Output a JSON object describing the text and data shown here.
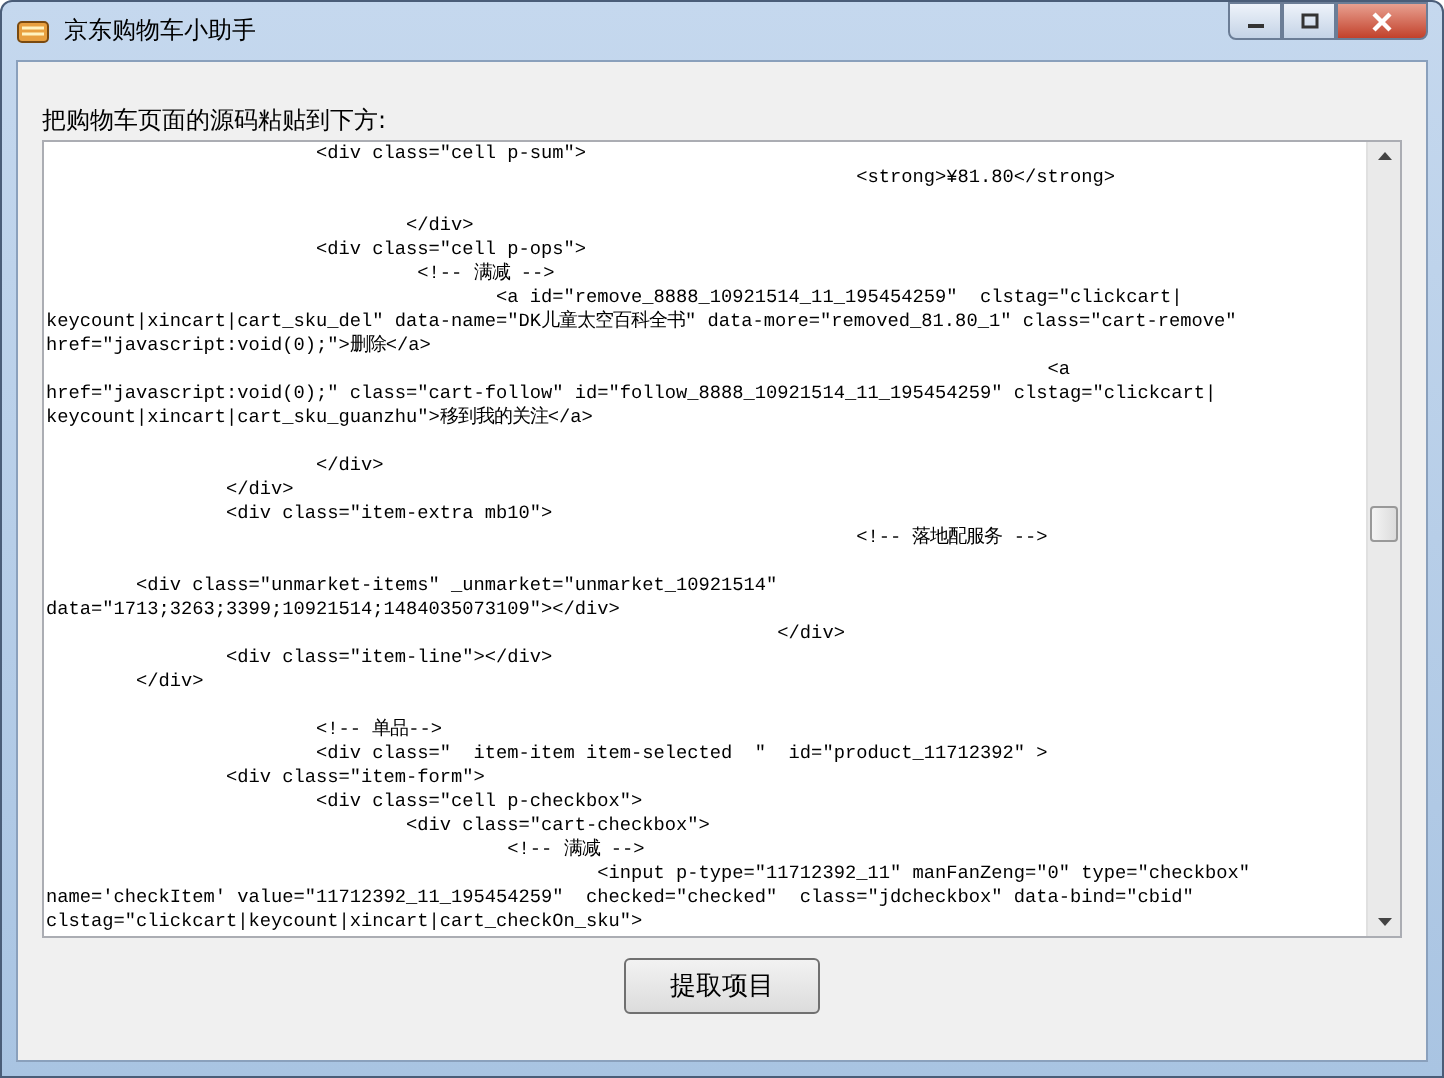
{
  "window": {
    "title": "京东购物车小助手"
  },
  "prompt": "把购物车页面的源码粘贴到下方:",
  "source_field": {
    "value": "                        <div class=\"cell p-sum\">\n                                                                        <strong>¥81.80</strong>\n\n                                </div>\n                        <div class=\"cell p-ops\">\n                                 <!-- 满减 -->\n                                        <a id=\"remove_8888_10921514_11_195454259\"  clstag=\"clickcart|\nkeycount|xincart|cart_sku_del\" data-name=\"DK儿童太空百科全书\" data-more=\"removed_81.80_1\" class=\"cart-remove\"\nhref=\"javascript:void(0);\">删除</a>\n                                                                                         <a\nhref=\"javascript:void(0);\" class=\"cart-follow\" id=\"follow_8888_10921514_11_195454259\" clstag=\"clickcart|\nkeycount|xincart|cart_sku_guanzhu\">移到我的关注</a>\n\n                        </div>\n                </div>\n                <div class=\"item-extra mb10\">\n                                                                        <!-- 落地配服务 -->\n\n        <div class=\"unmarket-items\" _unmarket=\"unmarket_10921514\"\ndata=\"1713;3263;3399;10921514;1484035073109\"></div>\n                                                                 </div>\n                <div class=\"item-line\"></div>\n        </div>\n\n                        <!-- 单品-->\n                        <div class=\"  item-item item-selected  \"  id=\"product_11712392\" >\n                <div class=\"item-form\">\n                        <div class=\"cell p-checkbox\">\n                                <div class=\"cart-checkbox\">\n                                         <!-- 满减 -->\n                                                 <input p-type=\"11712392_11\" manFanZeng=\"0\" type=\"checkbox\"\nname='checkItem' value=\"11712392_11_195454259\"  checked=\"checked\"  class=\"jdcheckbox\" data-bind=\"cbid\"\nclstag=\"clickcart|keycount|xincart|cart_checkOn_sku\">"
  },
  "buttons": [
    {
      "label": "提取项目"
    }
  ]
}
